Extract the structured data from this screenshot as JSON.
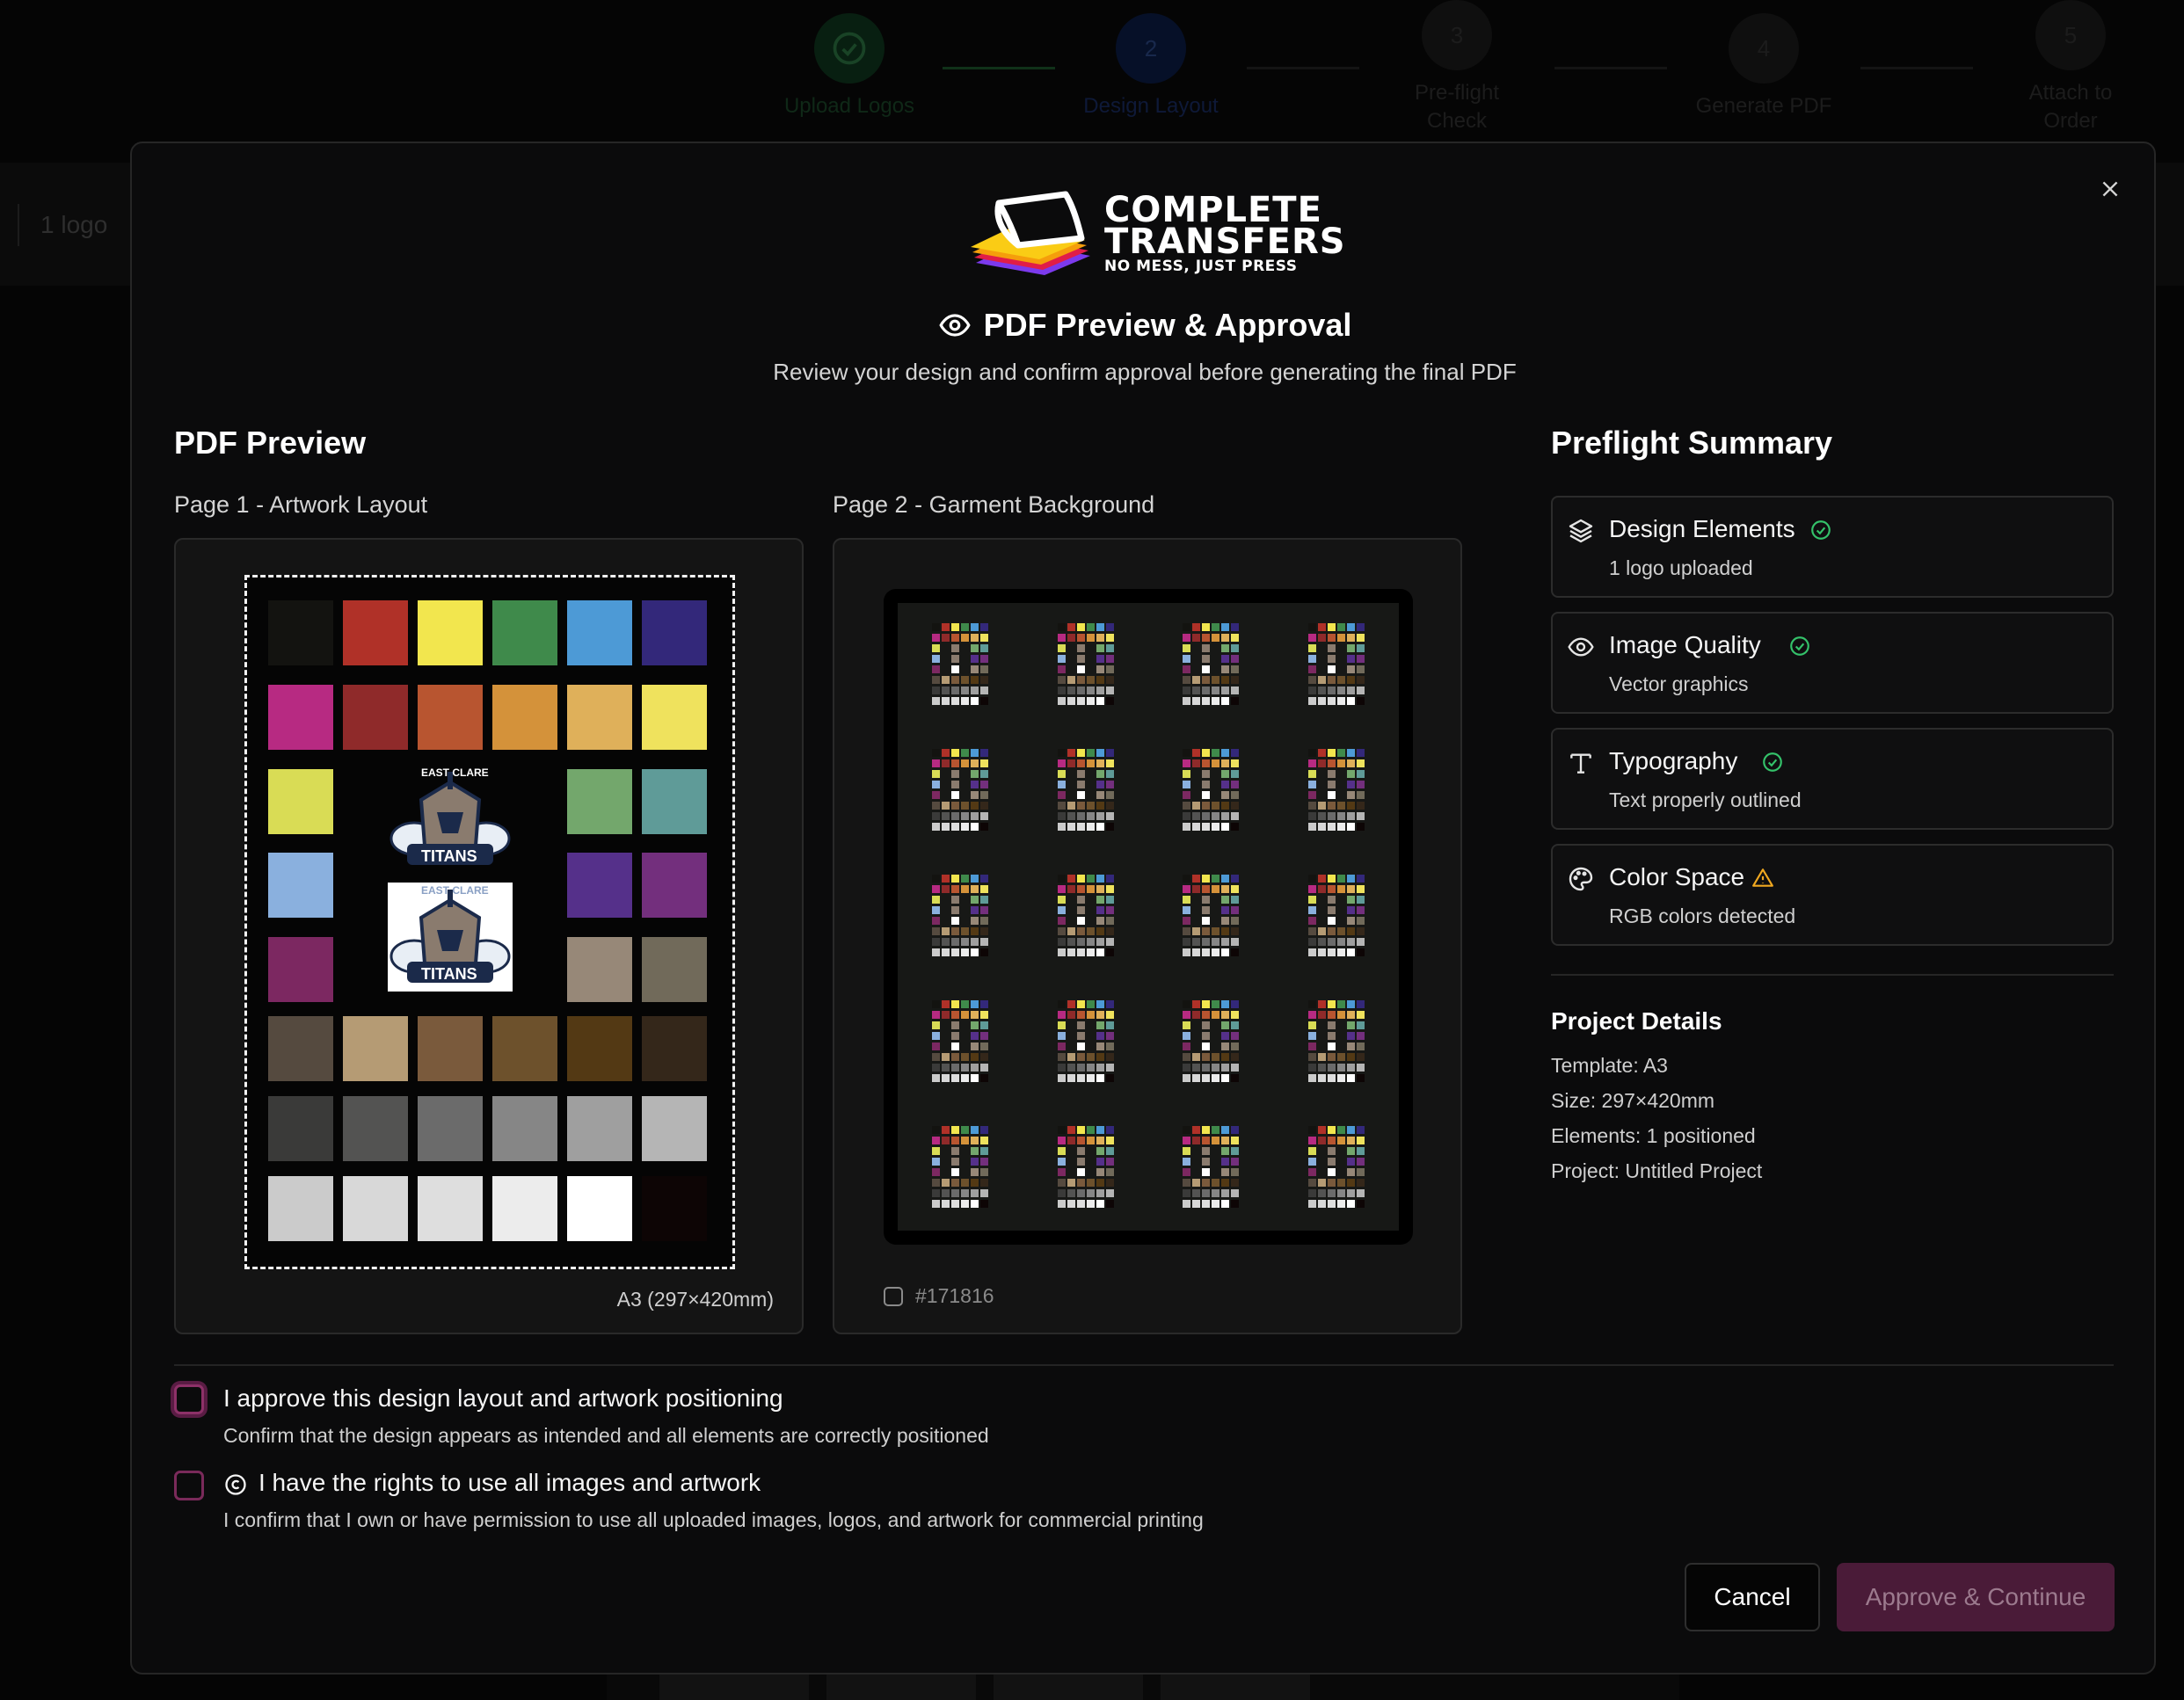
{
  "stepper": {
    "steps": [
      {
        "number": "",
        "label": "Upload Logos",
        "state": "complete"
      },
      {
        "number": "2",
        "label": "Design Layout",
        "state": "active"
      },
      {
        "number": "3",
        "label": "Pre-flight Check",
        "state": "pending"
      },
      {
        "number": "4",
        "label": "Generate PDF",
        "state": "pending"
      },
      {
        "number": "5",
        "label": "Attach to Order",
        "state": "pending"
      }
    ]
  },
  "background_toolbar": {
    "logo_count": "1 logo"
  },
  "modal": {
    "brand": {
      "line1": "COMPLETE",
      "line2": "TRANSFERS",
      "tagline": "NO MESS, JUST PRESS"
    },
    "title": "PDF Preview & Approval",
    "subtitle": "Review your design and confirm approval before generating the final PDF",
    "preview": {
      "heading": "PDF Preview",
      "page1": {
        "label": "Page 1 - Artwork Layout",
        "caption": "A3 (297×420mm)",
        "logo_text": {
          "arc": "EAST CLARE",
          "name": "TITANS"
        },
        "swatches": [
          "#131310",
          "#b03128",
          "#f2e64e",
          "#3f8a4b",
          "#4d9ad6",
          "#33287a",
          "#b72a82",
          "#8f2a2a",
          "#b85530",
          "#d4923a",
          "#dfb05a",
          "#efe25d",
          "#d9dc55",
          "#73a76c",
          "#5f9b98",
          "#8ab0de",
          "#55308a",
          "#732f7d",
          "#7c2861",
          "#978878",
          "#716a5a",
          "#554a3f",
          "#b59b74",
          "#7a5a3c",
          "#6d512c",
          "#533914",
          "#34271a",
          "#3a3a39",
          "#535352",
          "#6b6b6b",
          "#868686",
          "#9f9f9f",
          "#b5b5b5",
          "#cbcbcb",
          "#d8d8d8",
          "#dedede",
          "#ececec",
          "#ffffff",
          "#0d0505"
        ]
      },
      "page2": {
        "label": "Page 2 - Garment Background",
        "garment_color": "#171816",
        "tile_rows": 5,
        "tile_cols": 4
      }
    },
    "preflight": {
      "heading": "Preflight Summary",
      "items": [
        {
          "icon": "layers-icon",
          "name": "Design Elements",
          "status": "ok",
          "detail": "1 logo uploaded"
        },
        {
          "icon": "eye-icon",
          "name": "Image Quality",
          "status": "ok",
          "detail": "Vector graphics"
        },
        {
          "icon": "type-icon",
          "name": "Typography",
          "status": "ok",
          "detail": "Text properly outlined"
        },
        {
          "icon": "palette-icon",
          "name": "Color Space",
          "status": "warning",
          "detail": "RGB colors detected"
        }
      ]
    },
    "project": {
      "heading": "Project Details",
      "lines": [
        "Template: A3",
        "Size: 297×420mm",
        "Elements: 1 positioned",
        "Project: Untitled Project"
      ]
    },
    "approvals": [
      {
        "label": "I approve this design layout and artwork positioning",
        "detail": "Confirm that the design appears as intended and all elements are correctly positioned",
        "checked": false
      },
      {
        "label": "I have the rights to use all images and artwork",
        "detail": "I confirm that I own or have permission to use all uploaded images, logos, and artwork for commercial printing",
        "checked": false
      }
    ],
    "actions": {
      "cancel": "Cancel",
      "approve": "Approve & Continue"
    },
    "colors": {
      "accent": "#4a1b38",
      "ok": "#34c26a",
      "warning": "#f0a820",
      "checkbox": "#7a2a5a"
    }
  }
}
